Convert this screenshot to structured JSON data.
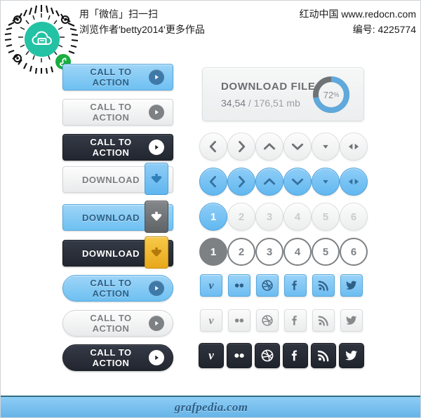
{
  "header": {
    "left_lines": [
      "用「微信」扫一扫",
      "浏览作者'betty2014'更多作品"
    ],
    "right_lines": [
      "红动中国 www.redocn.com",
      "编号: 4225774"
    ],
    "qr_icon": "cloud-print-icon",
    "qr_badge_icon": "wechat-icon"
  },
  "left_column": {
    "buttons": [
      {
        "label": "CALL TO ACTION",
        "style": "blue",
        "shape": "square",
        "icon": "play-icon"
      },
      {
        "label": "CALL TO ACTION",
        "style": "light",
        "shape": "square",
        "icon": "play-icon"
      },
      {
        "label": "CALL TO ACTION",
        "style": "dark",
        "shape": "square",
        "icon": "play-icon"
      },
      {
        "label": "DOWNLOAD",
        "style": "light",
        "shape": "square",
        "icon": "download-arrow-icon",
        "tab": "blue"
      },
      {
        "label": "DOWNLOAD",
        "style": "blue",
        "shape": "square",
        "icon": "download-arrow-icon",
        "tab": "grey"
      },
      {
        "label": "DOWNLOAD",
        "style": "dark",
        "shape": "square",
        "icon": "download-arrow-icon",
        "tab": "gold"
      },
      {
        "label": "CALL TO ACTION",
        "style": "blue",
        "shape": "pill",
        "icon": "play-icon"
      },
      {
        "label": "CALL TO ACTION",
        "style": "light",
        "shape": "pill",
        "icon": "play-icon"
      },
      {
        "label": "CALL TO ACTION",
        "style": "dark",
        "shape": "pill",
        "icon": "play-icon"
      }
    ]
  },
  "download_card": {
    "title": "DOWNLOAD FILE",
    "downloaded": "34,54",
    "separator": " / ",
    "total": "176,51 mb",
    "percent": 72,
    "percent_label": "72",
    "percent_unit": "%",
    "ring_color": "#5fa9dc",
    "ring_track_color": "#6f7376"
  },
  "arrow_rows": [
    {
      "style": "light",
      "items": [
        {
          "icon": "chevron-left-icon"
        },
        {
          "icon": "chevron-right-icon"
        },
        {
          "icon": "chevron-up-icon"
        },
        {
          "icon": "chevron-down-icon"
        },
        {
          "icon": "triangle-down-icon"
        },
        {
          "icon": "arrows-left-right-icon"
        }
      ]
    },
    {
      "style": "blue",
      "items": [
        {
          "icon": "chevron-left-icon"
        },
        {
          "icon": "chevron-right-icon"
        },
        {
          "icon": "chevron-up-icon"
        },
        {
          "icon": "chevron-down-icon"
        },
        {
          "icon": "triangle-down-icon"
        },
        {
          "icon": "arrows-left-right-icon"
        }
      ]
    }
  ],
  "pagination_rows": [
    {
      "style": "filled",
      "active_index": 0,
      "pages": [
        "1",
        "2",
        "3",
        "4",
        "5",
        "6"
      ]
    },
    {
      "style": "outline",
      "active_index": 0,
      "pages": [
        "1",
        "2",
        "3",
        "4",
        "5",
        "6"
      ]
    }
  ],
  "social_rows": [
    {
      "style": "blue",
      "items": [
        "vimeo-icon",
        "flickr-icon",
        "dribbble-icon",
        "facebook-icon",
        "rss-icon",
        "twitter-icon"
      ]
    },
    {
      "style": "light",
      "items": [
        "vimeo-icon",
        "flickr-icon",
        "dribbble-icon",
        "facebook-icon",
        "rss-icon",
        "twitter-icon"
      ]
    },
    {
      "style": "dark",
      "items": [
        "vimeo-icon",
        "flickr-icon",
        "dribbble-icon",
        "facebook-icon",
        "rss-icon",
        "twitter-icon"
      ]
    }
  ],
  "footer": {
    "text": "grafpedia.com"
  }
}
